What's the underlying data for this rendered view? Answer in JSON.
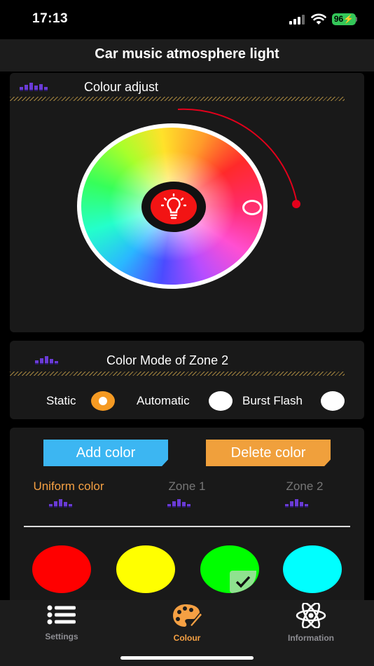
{
  "status_bar": {
    "time": "17:13",
    "battery": "96"
  },
  "nav": {
    "title": "Car music atmosphere light"
  },
  "colour_adjust": {
    "title": "Colour adjust"
  },
  "color_mode": {
    "title": "Color Mode of Zone 2",
    "options": [
      {
        "label": "Static",
        "selected": true
      },
      {
        "label": "Automatic",
        "selected": false
      },
      {
        "label": "Burst Flash",
        "selected": false
      }
    ]
  },
  "zones": {
    "add_label": "Add color",
    "delete_label": "Delete color",
    "tabs": [
      {
        "label": "Uniform color",
        "active": true
      },
      {
        "label": "Zone 1",
        "active": false
      },
      {
        "label": "Zone 2",
        "active": false
      }
    ],
    "swatches": [
      {
        "color": "#ff0000",
        "selected": false
      },
      {
        "color": "#ffff00",
        "selected": false
      },
      {
        "color": "#00ff00",
        "selected": true
      },
      {
        "color": "#00ffff",
        "selected": false
      }
    ]
  },
  "tab_bar": {
    "items": [
      {
        "label": "Settings",
        "icon": "list-icon",
        "active": false
      },
      {
        "label": "Colour",
        "icon": "palette-icon",
        "active": true
      },
      {
        "label": "Information",
        "icon": "atom-icon",
        "active": false
      }
    ]
  },
  "colors": {
    "accent": "#f5a043",
    "add": "#3cb6f2",
    "delete": "#f0a03c",
    "lamp": "#f21414"
  }
}
